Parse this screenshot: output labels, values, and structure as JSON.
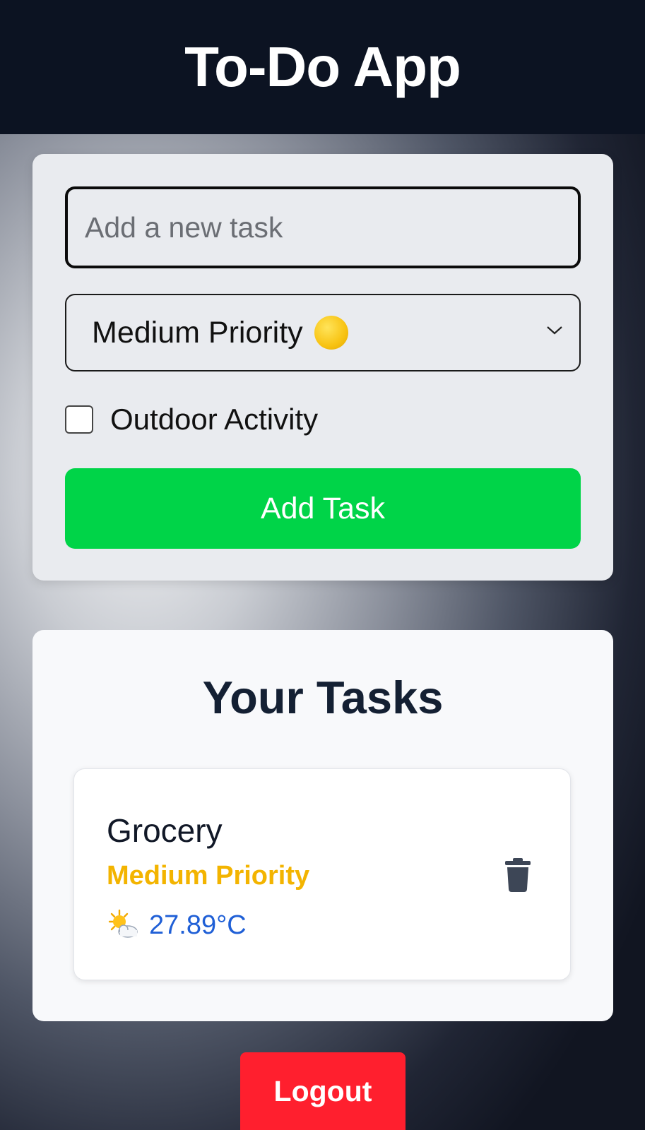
{
  "header": {
    "title": "To-Do App"
  },
  "form": {
    "task_placeholder": "Add a new task",
    "task_value": "",
    "priority_selected": "Medium Priority",
    "priority_icon": "yellow-circle",
    "priority_color": "#f8c312",
    "outdoor_label": "Outdoor Activity",
    "outdoor_checked": false,
    "add_button_label": "Add Task",
    "add_button_color": "#00d448"
  },
  "tasks": {
    "title": "Your Tasks",
    "items": [
      {
        "name": "Grocery",
        "priority_label": "Medium Priority",
        "priority_color": "#f3b400",
        "weather_icon": "sun-behind-cloud-icon",
        "temperature": "27.89°C",
        "delete_icon": "trash-icon"
      }
    ]
  },
  "logout": {
    "label": "Logout",
    "color": "#ff1f2e"
  }
}
